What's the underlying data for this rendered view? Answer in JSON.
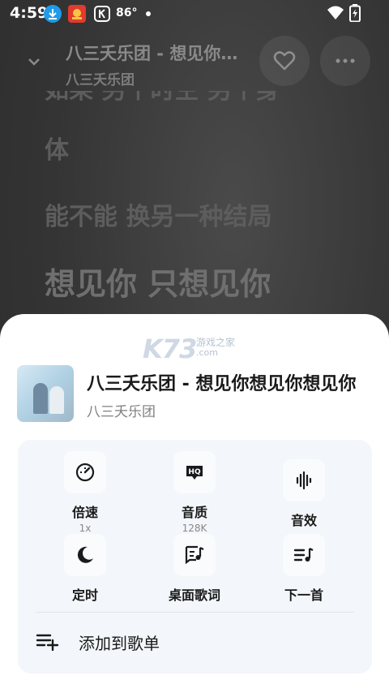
{
  "status_bar": {
    "time": "4:59",
    "temperature": "86°"
  },
  "header": {
    "title": "八三夭乐团 - 想见你想见你想见你",
    "artist": "八三夭乐团"
  },
  "lyrics": {
    "line1": "如果 另个时空 另个身",
    "line2": "体",
    "line3": "能不能 换另一种结局",
    "current": "想见你 只想见你"
  },
  "sheet": {
    "watermark_brand": "K73",
    "watermark_text": "游戏之家",
    "watermark_domain": ".com",
    "title": "八三夭乐团 - 想见你想见你想见你",
    "artist": "八三夭乐团",
    "options": [
      {
        "label": "倍速",
        "sub": "1x",
        "icon": "speedometer-icon"
      },
      {
        "label": "音质",
        "sub": "128K",
        "icon": "hq-icon"
      },
      {
        "label": "音效",
        "sub": "",
        "icon": "sound-wave-icon"
      },
      {
        "label": "定时",
        "sub": "",
        "icon": "moon-icon"
      },
      {
        "label": "桌面歌词",
        "sub": "",
        "icon": "desktop-lyrics-icon"
      },
      {
        "label": "下一首",
        "sub": "",
        "icon": "play-next-icon"
      }
    ],
    "add_to_playlist": "添加到歌单"
  },
  "colors": {
    "sheet_background": "#ffffff",
    "panel_background": "#f3f6fa",
    "player_background": "#343434"
  }
}
